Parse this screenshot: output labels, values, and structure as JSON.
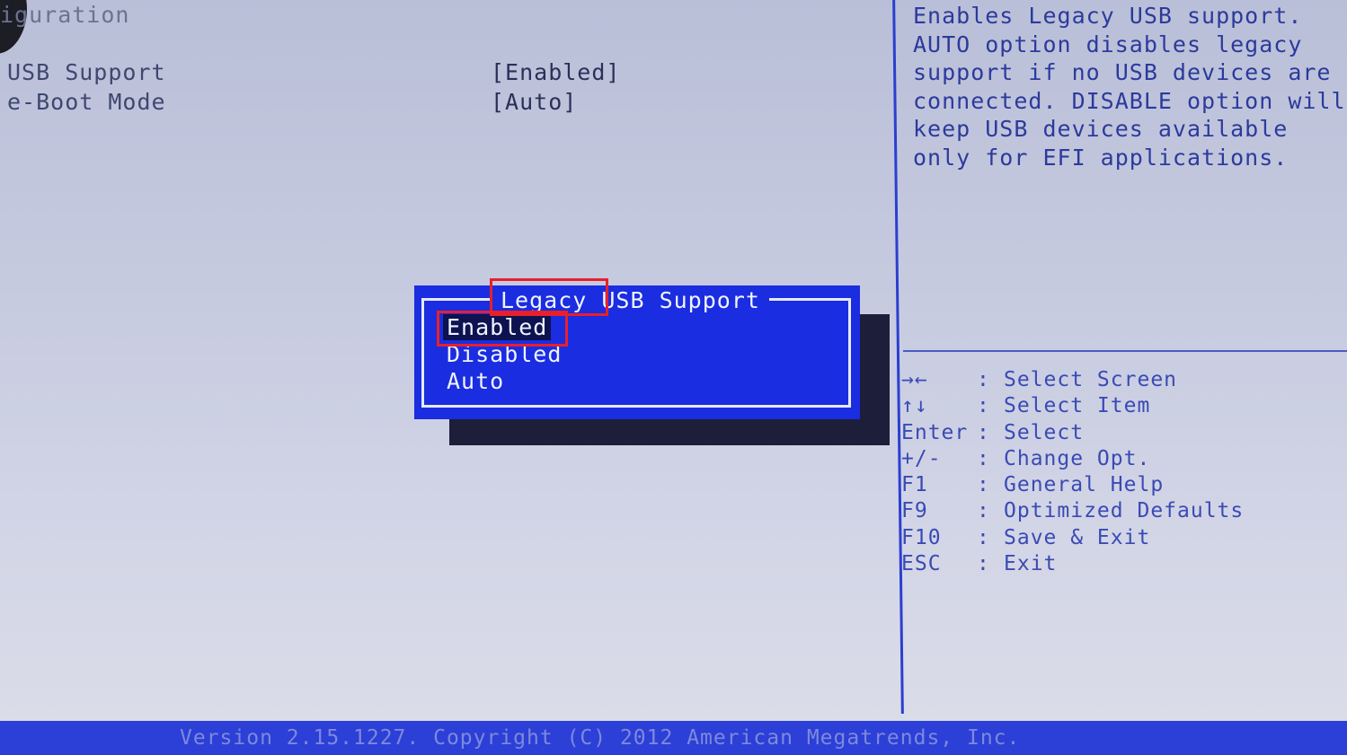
{
  "page": {
    "section_title": "iguration",
    "settings": [
      {
        "name": "USB Support",
        "value": "[Enabled]"
      },
      {
        "name": "e-Boot Mode",
        "value": "[Auto]"
      }
    ]
  },
  "help": {
    "lines": [
      "Enables Legacy USB support.",
      "AUTO option disables legacy",
      "support if no USB devices are",
      "connected. DISABLE option will",
      "keep USB devices available",
      "only for EFI applications."
    ]
  },
  "legend": [
    {
      "key": "→←",
      "sep": ":",
      "desc": "Select Screen"
    },
    {
      "key": "↑↓",
      "sep": ":",
      "desc": "Select Item"
    },
    {
      "key": "Enter",
      "sep": ":",
      "desc": "Select"
    },
    {
      "key": "+/-",
      "sep": ":",
      "desc": "Change Opt."
    },
    {
      "key": "F1",
      "sep": ":",
      "desc": "General Help"
    },
    {
      "key": "F9",
      "sep": ":",
      "desc": "Optimized Defaults"
    },
    {
      "key": "F10",
      "sep": ":",
      "desc": "Save & Exit"
    },
    {
      "key": "ESC",
      "sep": ":",
      "desc": "Exit"
    }
  ],
  "popup": {
    "title": "Legacy USB Support",
    "options": [
      "Enabled",
      "Disabled",
      "Auto"
    ],
    "selected": "Enabled"
  },
  "footer": {
    "text": "Version 2.15.1227. Copyright (C) 2012 American Megatrends, Inc."
  },
  "colors": {
    "background": "#c7cbe0",
    "popup": "#1a2de0",
    "accent_blue": "#2b3fd0",
    "annotation_red": "#e8202a"
  }
}
